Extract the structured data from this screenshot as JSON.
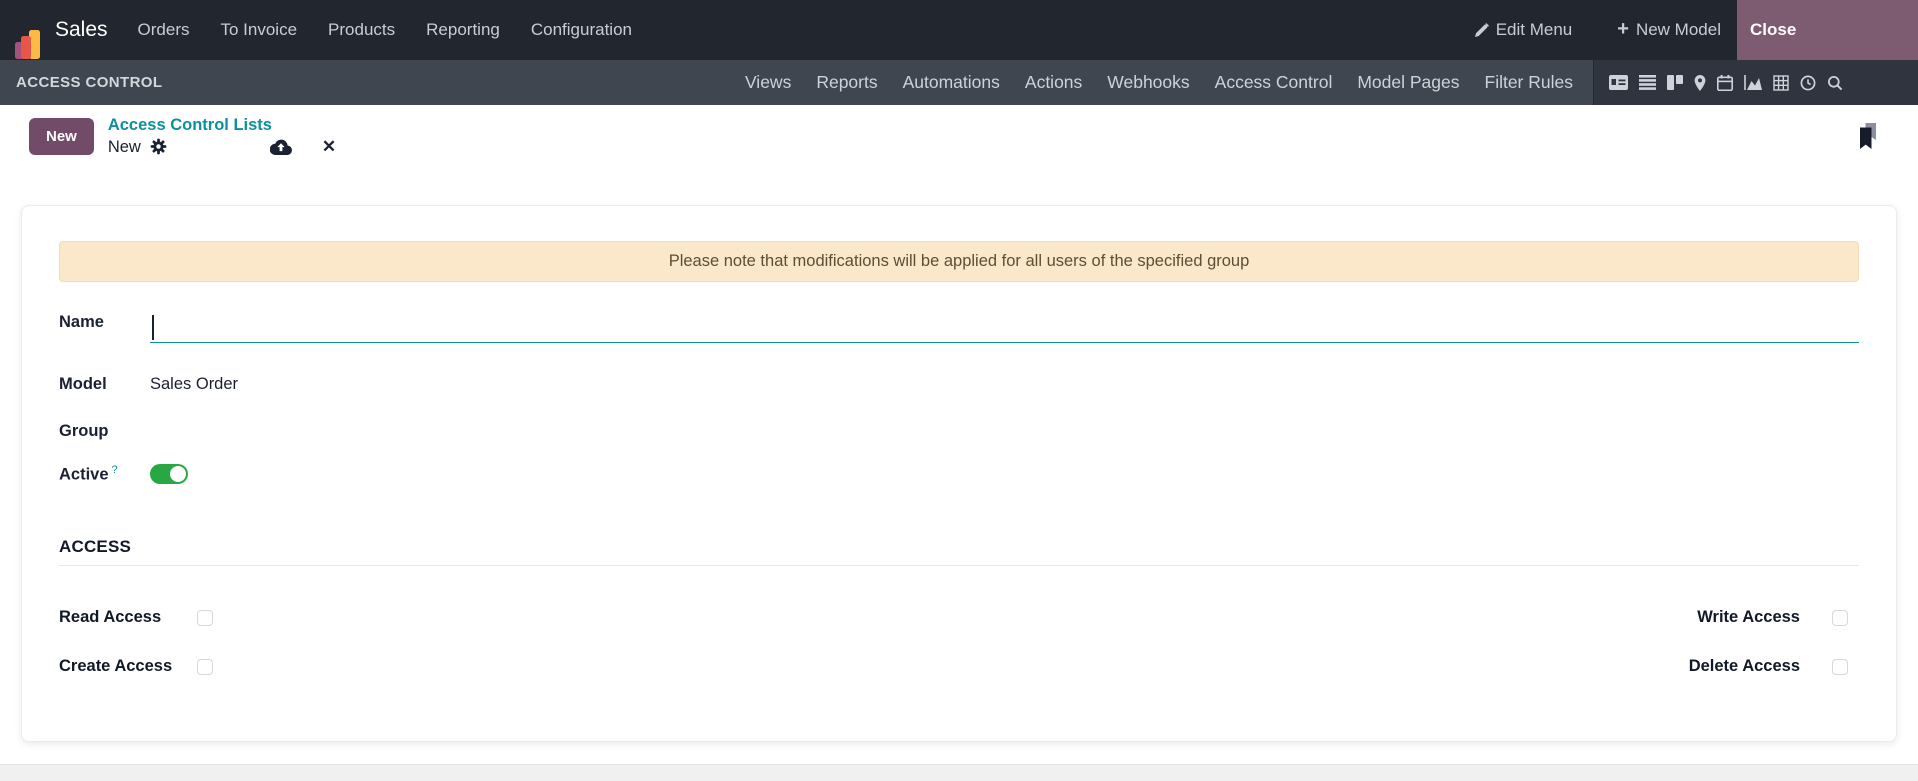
{
  "colors": {
    "topbar-bg": "#22272f",
    "studio-bar-bg": "#3f4650",
    "icon-panel-bg": "#2f343e",
    "brand-purple": "#714B67",
    "close-bg": "#7d5b70",
    "teal": "#0d8f9c",
    "toggle-green": "#28a745",
    "banner-bg": "#fbe8cb",
    "banner-text": "#5d4e34",
    "nav-text": "#c9ccd2"
  },
  "topbar": {
    "app_name": "Sales",
    "menus": [
      "Orders",
      "To Invoice",
      "Products",
      "Reporting",
      "Configuration"
    ],
    "edit_menu_label": "Edit Menu",
    "new_model_label": "New Model",
    "close_label": "Close"
  },
  "studio_bar": {
    "title": "ACCESS CONTROL",
    "tabs": [
      "Views",
      "Reports",
      "Automations",
      "Actions",
      "Webhooks",
      "Access Control",
      "Model Pages",
      "Filter Rules"
    ],
    "active_tab": "Access Control",
    "view_switcher_icons": [
      "form-icon",
      "list-icon",
      "kanban-icon",
      "map-icon",
      "calendar-icon",
      "graph-icon",
      "pivot-icon",
      "activity-icon",
      "search-icon"
    ]
  },
  "breadcrumb": {
    "new_button_label": "New",
    "parent_link": "Access Control Lists",
    "current": "New"
  },
  "form": {
    "banner_text": "Please note that modifications will be applied for all users of the specified group",
    "fields": {
      "name": {
        "label": "Name",
        "value": ""
      },
      "model": {
        "label": "Model",
        "value": "Sales Order"
      },
      "group": {
        "label": "Group",
        "value": ""
      },
      "active": {
        "label": "Active",
        "help": "?",
        "enabled": true
      }
    },
    "section_title": "ACCESS",
    "access": {
      "read": {
        "label": "Read Access",
        "checked": false
      },
      "write": {
        "label": "Write Access",
        "checked": false
      },
      "create": {
        "label": "Create Access",
        "checked": false
      },
      "delete": {
        "label": "Delete Access",
        "checked": false
      }
    }
  }
}
